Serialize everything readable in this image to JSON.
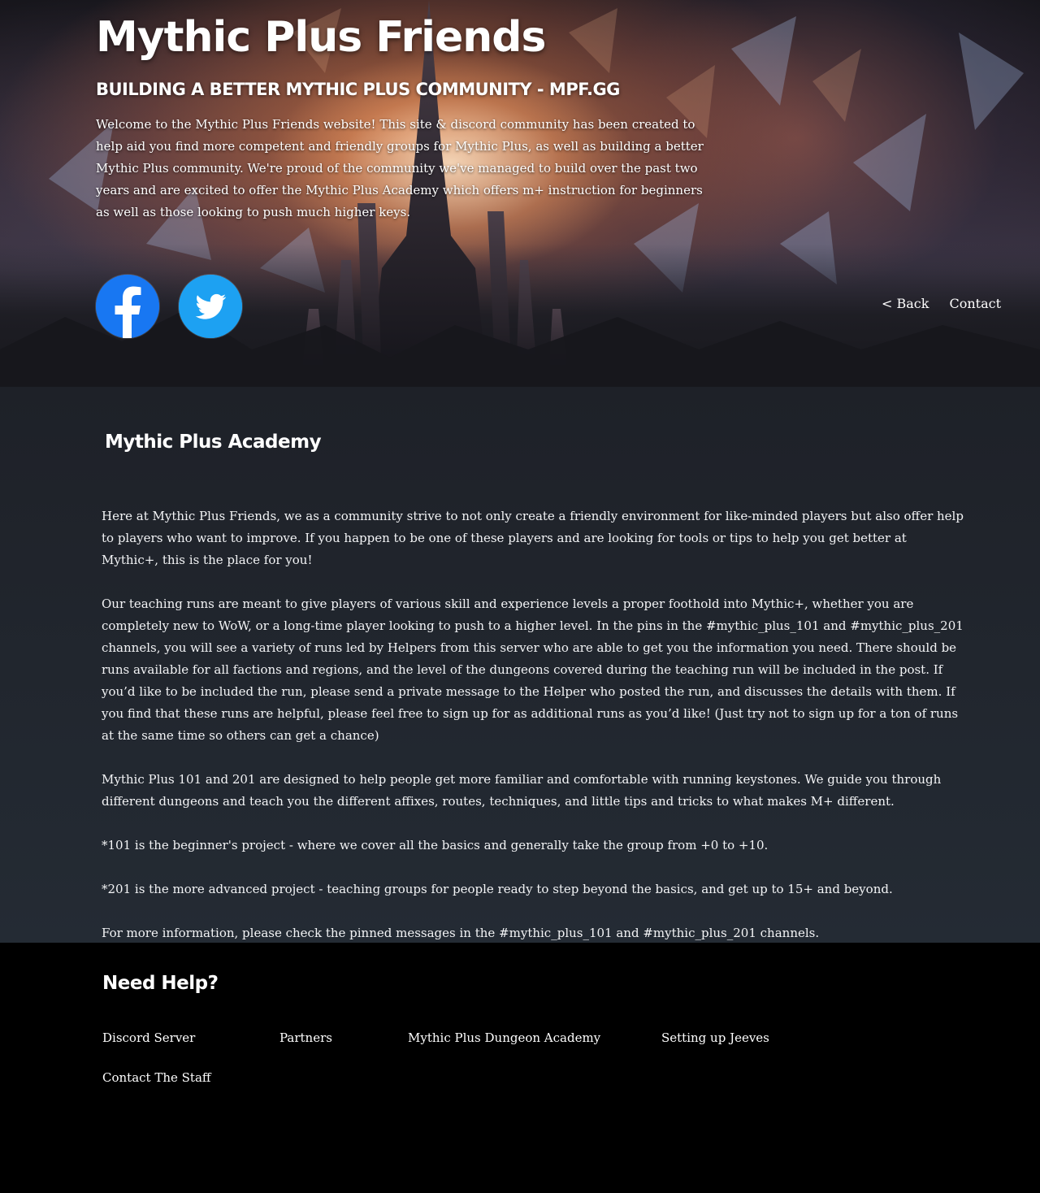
{
  "hero": {
    "title": "Mythic Plus Friends",
    "tagline": "BUILDING A BETTER MYTHIC PLUS COMMUNITY - MPF.GG",
    "intro": "Welcome to the Mythic Plus Friends website! This site & discord community has been created to help aid you find more competent and friendly groups for Mythic Plus, as well as building a better Mythic Plus community. We're proud of the community we've managed to build over the past two years and are excited to offer the Mythic Plus Academy which offers m+ instruction for beginners as well as those looking to push much higher keys.",
    "social": [
      {
        "icon": "facebook-icon",
        "color": "#1877f2"
      },
      {
        "icon": "twitter-icon",
        "color": "#1da1f2"
      }
    ],
    "nav": {
      "back": "< Back",
      "contact": "Contact"
    }
  },
  "main": {
    "title": "Mythic Plus Academy",
    "paragraphs": [
      "Here at Mythic Plus Friends, we as a community strive to not only create a friendly environment for like-minded players but also offer help to players who want to improve. If you happen to be one of these players and are looking for tools or tips to help you get better at Mythic+, this is the place for you!",
      "Our teaching runs are meant to give players of various skill and experience levels a proper foothold into Mythic+, whether you are completely new to WoW, or a long-time player looking to push to a higher level. In the pins in the #mythic_plus_101 and #mythic_plus_201 channels, you will see a variety of runs led by Helpers from this server who are able to get you the information you need. There should be runs available for all factions and regions, and the level of the dungeons covered during the teaching run will be included in the post. If you’d like to be included the run, please send a private message to the Helper who posted the run, and discusses the details with them. If you find that these runs are helpful, please feel free to sign up for as additional runs as you’d like! (Just try not to sign up for a ton of runs at the same time so others can get a chance)",
      "Mythic Plus 101 and 201 are designed to help people get more familiar and comfortable with running keystones. We guide you through different dungeons and teach you the different affixes, routes, techniques, and little tips and tricks to what makes M+ different.",
      "*101 is the beginner's project - where we cover all the basics and generally take the group from +0 to +10.",
      "*201 is the more advanced project - teaching groups for people ready to step beyond the basics, and get up to 15+ and beyond.",
      "For more information, please check the pinned messages in the #mythic_plus_101 and #mythic_plus_201 channels."
    ]
  },
  "footer": {
    "title": "Need Help?",
    "links": {
      "discord": "Discord Server",
      "partners": "Partners",
      "academy": "Mythic Plus Dungeon Academy",
      "jeeves": "Setting up Jeeves",
      "staff": "Contact The Staff"
    }
  }
}
